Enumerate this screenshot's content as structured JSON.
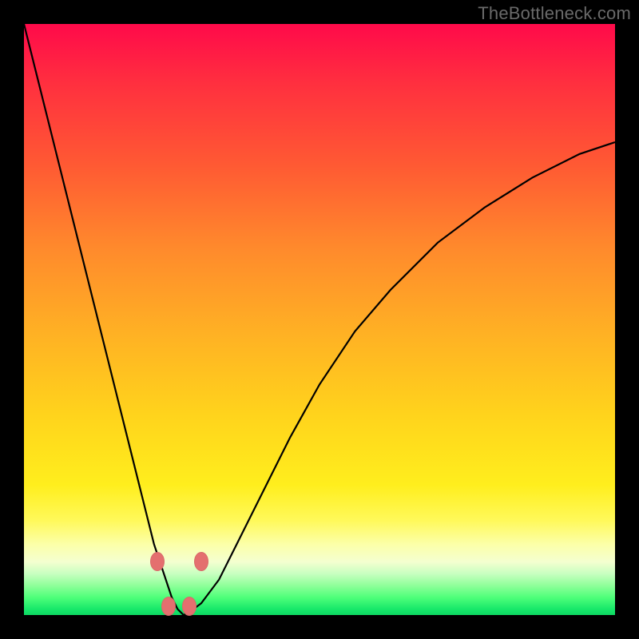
{
  "watermark": "TheBottleneck.com",
  "chart_data": {
    "type": "line",
    "title": "",
    "xlabel": "",
    "ylabel": "",
    "xlim": [
      0,
      100
    ],
    "ylim": [
      0,
      100
    ],
    "grid": false,
    "legend": false,
    "series": [
      {
        "name": "bottleneck-curve",
        "x": [
          0,
          2,
          4,
          6,
          8,
          10,
          12,
          14,
          16,
          18,
          20,
          22,
          23,
          24,
          25,
          26,
          27,
          28,
          30,
          33,
          36,
          40,
          45,
          50,
          56,
          62,
          70,
          78,
          86,
          94,
          100
        ],
        "y": [
          100,
          92,
          84,
          76,
          68,
          60,
          52,
          44,
          36,
          28,
          20,
          12,
          9,
          6,
          3,
          1,
          0,
          0.5,
          2,
          6,
          12,
          20,
          30,
          39,
          48,
          55,
          63,
          69,
          74,
          78,
          80
        ]
      }
    ],
    "markers": [
      {
        "name": "m1",
        "x": 22.5,
        "y": 9
      },
      {
        "name": "m2",
        "x": 24.5,
        "y": 1.5
      },
      {
        "name": "m3",
        "x": 28.0,
        "y": 1.5
      },
      {
        "name": "m4",
        "x": 30.0,
        "y": 9
      }
    ],
    "colors": {
      "curve": "#000000",
      "marker": "#e46f6f",
      "gradient_top": "#ff0a4a",
      "gradient_bottom": "#0ed862"
    }
  }
}
